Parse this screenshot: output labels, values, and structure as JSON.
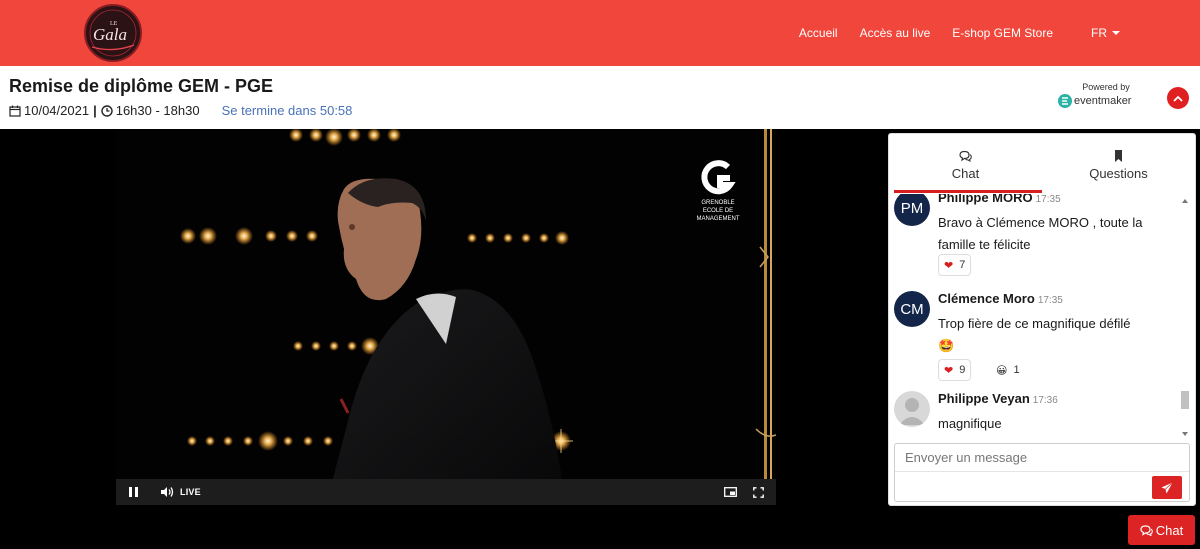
{
  "brand": {
    "logo_top": "LE",
    "logo_main": "Gala",
    "logo_icon": "gala-logo"
  },
  "nav": {
    "items": [
      {
        "label": "Accueil"
      },
      {
        "label": "Accès au live"
      },
      {
        "label": "E-shop GEM Store"
      }
    ],
    "language": "FR"
  },
  "event": {
    "title": "Remise de diplôme GEM - PGE",
    "date": "10/04/2021",
    "separator": "|",
    "time": "16h30 - 18h30",
    "countdown": "Se termine dans 50:58",
    "powered_by": "Powered by",
    "powered_brand": "eventmaker"
  },
  "video": {
    "overlay_logo": [
      "GRENOBLE",
      "ECOLE DE",
      "MANAGEMENT"
    ],
    "live_label": "LIVE",
    "colors": {
      "stage_light": "#ffc15a"
    }
  },
  "chat": {
    "tabs": [
      {
        "label": "Chat",
        "icon": "comments-icon"
      },
      {
        "label": "Questions",
        "icon": "bookmark-icon"
      }
    ],
    "messages": [
      {
        "initials": "PM",
        "author": "Philippe MORO",
        "time": "17:35",
        "text": "Bravo à Clémence MORO , toute la famille te félicite",
        "reactions": [
          {
            "emoji": "❤",
            "count": "7"
          }
        ]
      },
      {
        "initials": "CM",
        "author": "Clémence Moro",
        "time": "17:35",
        "text": "Trop fière de ce magnifique défilé",
        "emoji_line": "🤩",
        "reactions": [
          {
            "emoji": "❤",
            "count": "9"
          },
          {
            "emoji": "😀",
            "count": "1"
          }
        ]
      },
      {
        "initials": "",
        "author": "Philippe Veyan",
        "time": "17:36",
        "text": "magnifique"
      }
    ],
    "input_placeholder": "Envoyer un message",
    "float_button": "Chat"
  }
}
